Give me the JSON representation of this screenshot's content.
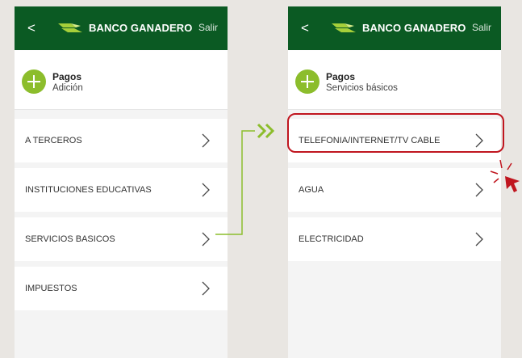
{
  "left_screen": {
    "topbar": {
      "back_glyph": "<",
      "brand": "BANCO GANADERO",
      "exit": "Salir"
    },
    "header": {
      "title": "Pagos",
      "subtitle": "Adición"
    },
    "items": [
      {
        "label": "A TERCEROS"
      },
      {
        "label": "INSTITUCIONES EDUCATIVAS"
      },
      {
        "label": "SERVICIOS BASICOS"
      },
      {
        "label": "IMPUESTOS"
      }
    ]
  },
  "right_screen": {
    "topbar": {
      "back_glyph": "<",
      "brand": "BANCO GANADERO",
      "exit": "Salir"
    },
    "header": {
      "title": "Pagos",
      "subtitle": "Servicios básicos"
    },
    "items": [
      {
        "label": "TELEFONIA/INTERNET/TV CABLE"
      },
      {
        "label": "AGUA"
      },
      {
        "label": "ELECTRICIDAD"
      }
    ]
  },
  "colors": {
    "brand_green": "#0b5a23",
    "accent_green": "#8cbd2c",
    "highlight_red": "#c0161f"
  },
  "icons": {
    "back": "chevron-left-icon",
    "logo": "bird-logo-icon",
    "add": "plus-circle-icon",
    "row": "chevron-right-icon",
    "pointer": "click-cursor-icon"
  }
}
